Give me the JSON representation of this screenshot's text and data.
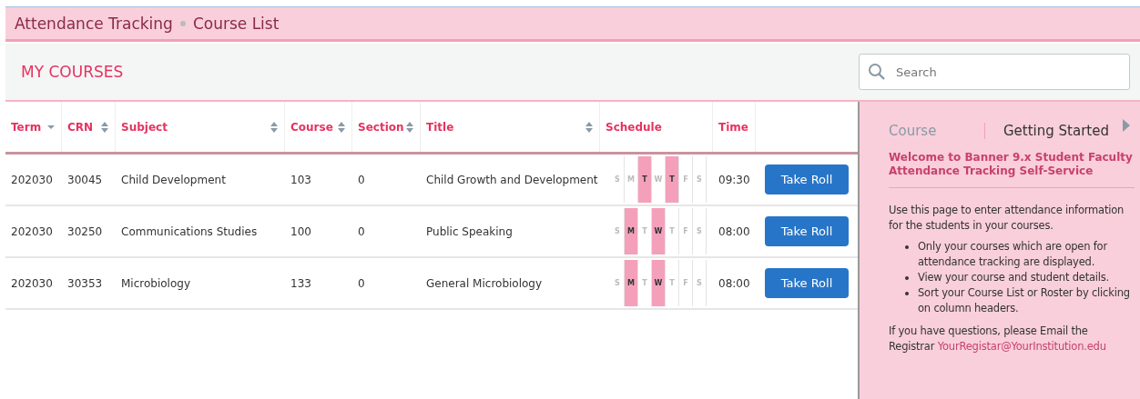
{
  "breadcrumb": [
    "Attendance Tracking",
    "Course List"
  ],
  "section_title": "MY COURSES",
  "search": {
    "placeholder": "Search"
  },
  "table": {
    "columns": [
      {
        "label": "Term",
        "kind": "sorted"
      },
      {
        "label": "CRN",
        "kind": "sortable"
      },
      {
        "label": "Subject",
        "kind": "sortable"
      },
      {
        "label": "Course",
        "kind": "sortable"
      },
      {
        "label": "Section",
        "kind": "sortable"
      },
      {
        "label": "Title",
        "kind": "sortable"
      },
      {
        "label": "Schedule",
        "kind": "plain"
      },
      {
        "label": "Time",
        "kind": "plain"
      }
    ],
    "rows": [
      {
        "term": "202030",
        "crn": "30045",
        "subject": "Child Development",
        "course": "103",
        "section": "0",
        "title": "Child Growth and Development",
        "days": [
          {
            "letter": "S",
            "on": false
          },
          {
            "letter": "M",
            "on": false
          },
          {
            "letter": "T",
            "on": true
          },
          {
            "letter": "W",
            "on": false
          },
          {
            "letter": "T",
            "on": true
          },
          {
            "letter": "F",
            "on": false
          },
          {
            "letter": "S",
            "on": false
          }
        ],
        "time": "09:30",
        "button": "Take Roll"
      },
      {
        "term": "202030",
        "crn": "30250",
        "subject": "Communications Studies",
        "course": "100",
        "section": "0",
        "title": "Public Speaking",
        "days": [
          {
            "letter": "S",
            "on": false
          },
          {
            "letter": "M",
            "on": true
          },
          {
            "letter": "T",
            "on": false
          },
          {
            "letter": "W",
            "on": true
          },
          {
            "letter": "T",
            "on": false
          },
          {
            "letter": "F",
            "on": false
          },
          {
            "letter": "S",
            "on": false
          }
        ],
        "time": "08:00",
        "button": "Take Roll"
      },
      {
        "term": "202030",
        "crn": "30353",
        "subject": "Microbiology",
        "course": "133",
        "section": "0",
        "title": "General Microbiology",
        "days": [
          {
            "letter": "S",
            "on": false
          },
          {
            "letter": "M",
            "on": true
          },
          {
            "letter": "T",
            "on": false
          },
          {
            "letter": "W",
            "on": true
          },
          {
            "letter": "T",
            "on": false
          },
          {
            "letter": "F",
            "on": false
          },
          {
            "letter": "S",
            "on": false
          }
        ],
        "time": "08:00",
        "button": "Take Roll"
      }
    ]
  },
  "sidebar": {
    "tabs": [
      {
        "label": "Course",
        "selected": false
      },
      {
        "label": "Getting Started",
        "selected": true
      }
    ],
    "heading": "Welcome to Banner 9.x Student Faculty Attendance Tracking Self-Service",
    "intro": "Use this page to enter attendance information for the students in your courses.",
    "bullets": [
      "Only your courses which are open for attendance tracking are displayed.",
      "View your course and student details.",
      "Sort your Course List or Roster by clicking on column headers."
    ],
    "footer": "If you have questions, please Email the Registrar",
    "email": "YourRegistar@YourInstitution.edu"
  }
}
